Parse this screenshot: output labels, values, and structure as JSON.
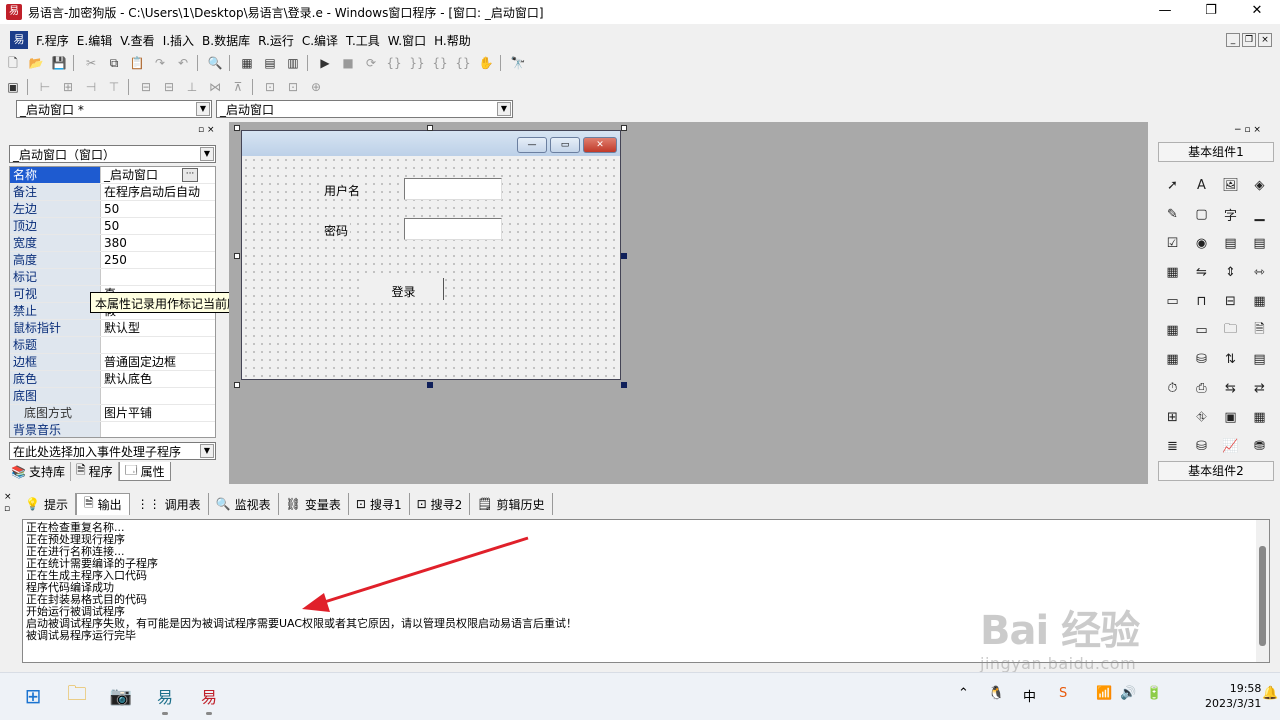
{
  "window": {
    "title": "易语言-加密狗版 - C:\\Users\\1\\Desktop\\易语言\\登录.e - Windows窗口程序 - [窗口: _启动窗口]",
    "controls": [
      "—",
      "❐",
      "✕"
    ]
  },
  "menu": [
    "F.程序",
    "E.编辑",
    "V.查看",
    "I.插入",
    "B.数据库",
    "R.运行",
    "C.编译",
    "T.工具",
    "W.窗口",
    "H.帮助"
  ],
  "mdi_controls": [
    "_",
    "❐",
    "×"
  ],
  "selector": {
    "left_combo": "_启动窗口 *",
    "right_combo": "_启动窗口"
  },
  "properties": {
    "object_combo": "_启动窗口（窗口）",
    "rows": [
      {
        "name": "名称",
        "value": "_启动窗口"
      },
      {
        "name": "备注",
        "value": "在程序启动后自动"
      },
      {
        "name": "左边",
        "value": "50"
      },
      {
        "name": "顶边",
        "value": "50"
      },
      {
        "name": "宽度",
        "value": "380"
      },
      {
        "name": "高度",
        "value": "250"
      },
      {
        "name": "标记",
        "value": ""
      },
      {
        "name": "可视",
        "value": "真"
      },
      {
        "name": "禁止",
        "value": "假"
      },
      {
        "name": "鼠标指针",
        "value": "默认型"
      },
      {
        "name": "标题",
        "value": ""
      },
      {
        "name": "边框",
        "value": "普通固定边框"
      },
      {
        "name": "底色",
        "value": "默认底色"
      },
      {
        "name": "底图",
        "value": ""
      },
      {
        "name": "底图方式",
        "value": "图片平铺"
      },
      {
        "name": "背景音乐",
        "value": ""
      }
    ],
    "event_combo": "在此处选择加入事件处理子程序",
    "tooltip": "本属性记录用作标记当前所选择对象的附加文本数据，以供在运行时使用"
  },
  "left_tabs": [
    "支持库",
    "程序",
    "属性"
  ],
  "form": {
    "label_user": "用户名",
    "label_password": "密码",
    "login_button": "登录"
  },
  "components": {
    "header1": "基本组件1",
    "header2": "基本组件2"
  },
  "bottom_tabs": [
    "提示",
    "输出",
    "调用表",
    "监视表",
    "变量表",
    "搜寻1",
    "搜寻2",
    "剪辑历史"
  ],
  "output_lines": [
    "正在检查重复名称...",
    "正在预处理现行程序",
    "正在进行名称连接...",
    "正在统计需要编译的子程序",
    "正在生成主程序入口代码",
    "程序代码编译成功",
    "正在封装易格式目的代码",
    "开始运行被调试程序",
    "启动被调试程序失败，有可能是因为被调试程序需要UAC权限或者其它原因，请以管理员权限启动易语言后重试！",
    "被调试易程序运行完毕"
  ],
  "watermark": {
    "line1": "Bai 经验",
    "line2": "jingyan.baidu.com"
  },
  "taskbar": {
    "time": "19:58",
    "date": "2023/3/31",
    "ime": "中"
  },
  "colors": {
    "arrow": "#e0202a",
    "selection": "#1e5bd0",
    "design_bg": "#a9a9a9"
  }
}
